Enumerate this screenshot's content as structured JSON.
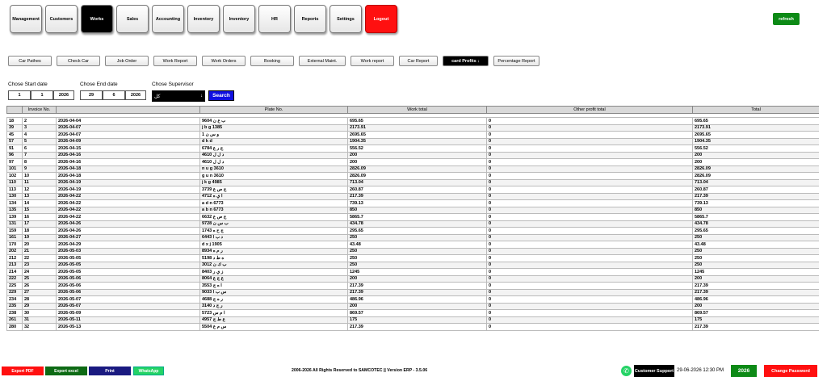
{
  "nav": {
    "items": [
      "Management",
      "Customers",
      "Works",
      "Sales",
      "Accounting",
      "Inventory",
      "Inventory",
      "HR",
      "Reports",
      "Settings",
      "Logout"
    ],
    "active_index": 2,
    "refresh_label": "refresh"
  },
  "subnav": {
    "items": [
      "Car Pathes",
      "Check Car",
      "Job Order",
      "Work Report",
      "Work Orders",
      "Booking",
      "External Maint.",
      "Work report",
      "Car Report",
      "card Profits ↓",
      "Percentage Report"
    ],
    "active_index": 9
  },
  "filters": {
    "start_label": "Chose Start date",
    "start_day": "1",
    "start_month": "1",
    "start_year": "2026",
    "end_label": "Chose End date",
    "end_day": "29",
    "end_month": "6",
    "end_year": "2026",
    "supervisor_label": "Chose Supervisor",
    "supervisor_value": "كل",
    "search_label": "Search"
  },
  "table": {
    "columns": [
      "",
      "Invoice No.",
      "",
      "Plate No.",
      "Work total",
      "Other profit total",
      "Total"
    ],
    "rows": [
      [
        "18",
        "2",
        "2026-04-04",
        "9604 ب ع ن",
        "695.65",
        "0",
        "695.65"
      ],
      [
        "39",
        "3",
        "2026-04-07",
        "j b g 1385",
        "2173.91",
        "0",
        "2173.91"
      ],
      [
        "45",
        "4",
        "2026-04-07",
        "و س ن 1",
        "2695.65",
        "0",
        "2695.65"
      ],
      [
        "57",
        "5",
        "2026-04-09",
        "d k d",
        "1904.35",
        "0",
        "1904.35"
      ],
      [
        "91",
        "6",
        "2026-04-15",
        "6784 ج ر ع",
        "556.52",
        "0",
        "556.52"
      ],
      [
        "96",
        "7",
        "2026-04-16",
        "4610 د ل ل",
        "200",
        "0",
        "200"
      ],
      [
        "97",
        "8",
        "2026-04-16",
        "4610 د ل ل",
        "200",
        "0",
        "200"
      ],
      [
        "101",
        "9",
        "2026-04-18",
        "n u g 3610",
        "2826.09",
        "0",
        "2826.09"
      ],
      [
        "102",
        "10",
        "2026-04-18",
        "g u n 3610",
        "2826.09",
        "0",
        "2826.09"
      ],
      [
        "110",
        "11",
        "2026-04-19",
        "j k g 4985",
        "713.04",
        "0",
        "713.04"
      ],
      [
        "113",
        "12",
        "2026-04-19",
        "3739 ج ص ع",
        "260.87",
        "0",
        "260.87"
      ],
      [
        "130",
        "13",
        "2026-04-22",
        "4712 ا ي ه",
        "217.39",
        "0",
        "217.39"
      ],
      [
        "134",
        "14",
        "2026-04-22",
        "a d n 6773",
        "739.13",
        "0",
        "739.13"
      ],
      [
        "135",
        "15",
        "2026-04-22",
        "a b n 6773",
        "850",
        "0",
        "850"
      ],
      [
        "139",
        "16",
        "2026-04-22",
        "6632 ج ص ع",
        "5865.7",
        "0",
        "5865.7"
      ],
      [
        "131",
        "17",
        "2026-04-26",
        "9728 ب س ن",
        "434.78",
        "0",
        "434.78"
      ],
      [
        "159",
        "18",
        "2026-04-26",
        "1743 ج ح ه",
        "295.65",
        "0",
        "295.65"
      ],
      [
        "161",
        "19",
        "2026-04-27",
        "6443 د ب ا",
        "250",
        "0",
        "250"
      ],
      [
        "170",
        "20",
        "2026-04-29",
        "d x j 1905",
        "43.48",
        "0",
        "43.48"
      ],
      [
        "202",
        "21",
        "2026-05-03",
        "8934 ر م ه",
        "250",
        "0",
        "250"
      ],
      [
        "212",
        "22",
        "2026-05-05",
        "5198 ه ط د",
        "250",
        "0",
        "250"
      ],
      [
        "213",
        "23",
        "2026-05-05",
        "3012 ب ك ن",
        "250",
        "0",
        "250"
      ],
      [
        "214",
        "24",
        "2026-05-05",
        "8403 ز ي ر",
        "1245",
        "0",
        "1245"
      ],
      [
        "222",
        "25",
        "2026-05-06",
        "8064 ع ج ع",
        "200",
        "0",
        "200"
      ],
      [
        "225",
        "26",
        "2026-05-06",
        "3553 ا ه ج",
        "217.39",
        "0",
        "217.39"
      ],
      [
        "229",
        "27",
        "2026-05-06",
        "9033 س ب ا",
        "217.39",
        "0",
        "217.39"
      ],
      [
        "234",
        "28",
        "2026-05-07",
        "4688 ر ه ج",
        "486.96",
        "0",
        "486.96"
      ],
      [
        "235",
        "29",
        "2026-05-07",
        "3140 ر ج د",
        "200",
        "0",
        "200"
      ],
      [
        "238",
        "30",
        "2026-05-09",
        "5723 ا م س",
        "869.57",
        "0",
        "869.57"
      ],
      [
        "261",
        "31",
        "2026-05-11",
        "4957 ع ط ج",
        "175",
        "0",
        "175"
      ],
      [
        "280",
        "32",
        "2026-05-13",
        "5504 س م ع",
        "217.39",
        "0",
        "217.39"
      ]
    ]
  },
  "footer": {
    "export_pdf": "Export PDF",
    "export_excel": "Export excel",
    "print": "Print",
    "whatsapp": "WhatsApp",
    "copyright": "2006-2026 All Rights Reserved to SAMCOTEC || Version ERP - 3.5.06",
    "support": "Customer Support",
    "datetime": "29-06-2026 12:30 PM",
    "year": "2026",
    "change_password": "Change Password"
  },
  "colors": {
    "red": "#ff1010",
    "green": "#0d8a16",
    "blue": "#1010e0",
    "navy": "#1a1a80",
    "whatsapp": "#25d366"
  },
  "icons": {
    "arrow_down": "↓",
    "whatsapp": "whatsapp-icon"
  }
}
